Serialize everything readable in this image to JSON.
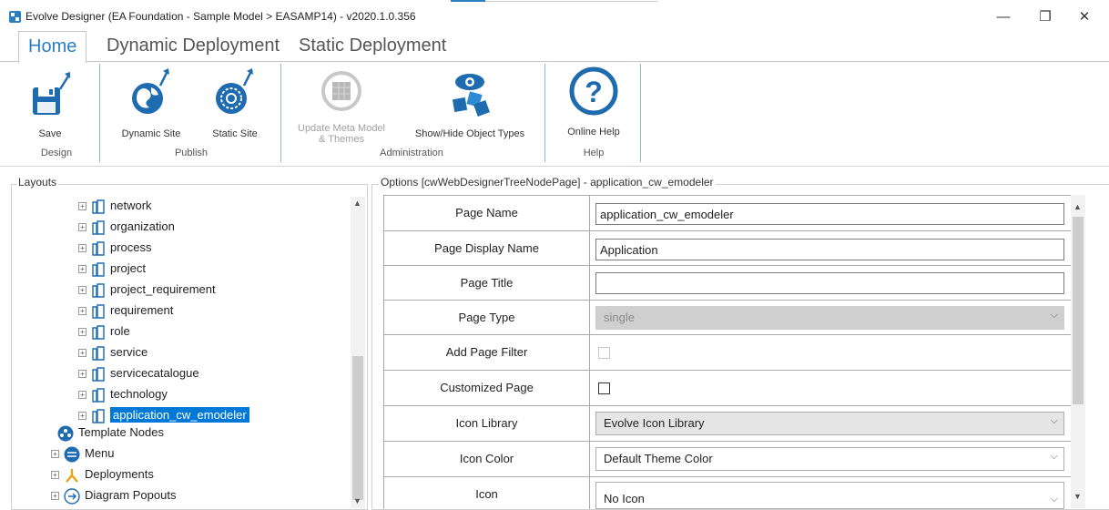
{
  "window": {
    "title": "Evolve Designer (EA Foundation - Sample Model > EASAMP14) - v2020.1.0.356",
    "controls": {
      "minimize": "—",
      "restore": "❐",
      "close": "✕"
    }
  },
  "tabs": [
    "Home",
    "Dynamic Deployment",
    "Static Deployment"
  ],
  "ribbon": {
    "buttons": {
      "save": "Save",
      "dynamic_site": "Dynamic Site",
      "static_site": "Static Site",
      "update_meta_line1": "Update Meta Model",
      "update_meta_line2": "& Themes",
      "show_hide": "Show/Hide Object Types",
      "online_help": "Online Help"
    },
    "groups": {
      "design": "Design",
      "publish": "Publish",
      "administration": "Administration",
      "help": "Help"
    }
  },
  "layouts": {
    "label": "Layouts",
    "tree": [
      "network",
      "organization",
      "process",
      "project",
      "project_requirement",
      "requirement",
      "role",
      "service",
      "servicecatalogue",
      "technology",
      "application_cw_emodeler"
    ],
    "root_nodes": [
      "Template Nodes",
      "Menu",
      "Deployments",
      "Diagram Popouts"
    ]
  },
  "options": {
    "label": "Options [cwWebDesignerTreeNodePage] - application_cw_emodeler",
    "rows": {
      "page_name": {
        "caption": "Page Name",
        "value": "application_cw_emodeler"
      },
      "page_display_name": {
        "caption": "Page Display Name",
        "value": "Application"
      },
      "page_title": {
        "caption": "Page Title",
        "value": ""
      },
      "page_type": {
        "caption": "Page Type",
        "value": "single"
      },
      "add_page_filter": {
        "caption": "Add Page Filter",
        "checked": false
      },
      "customized_page": {
        "caption": "Customized Page",
        "checked": false
      },
      "icon_library": {
        "caption": "Icon Library",
        "value": "Evolve Icon Library"
      },
      "icon_color": {
        "caption": "Icon Color",
        "value": "Default Theme Color"
      },
      "icon": {
        "caption": "Icon",
        "value": "No Icon"
      }
    }
  },
  "colors": {
    "accent": "#2b7fc1",
    "selection": "#0078d7"
  }
}
